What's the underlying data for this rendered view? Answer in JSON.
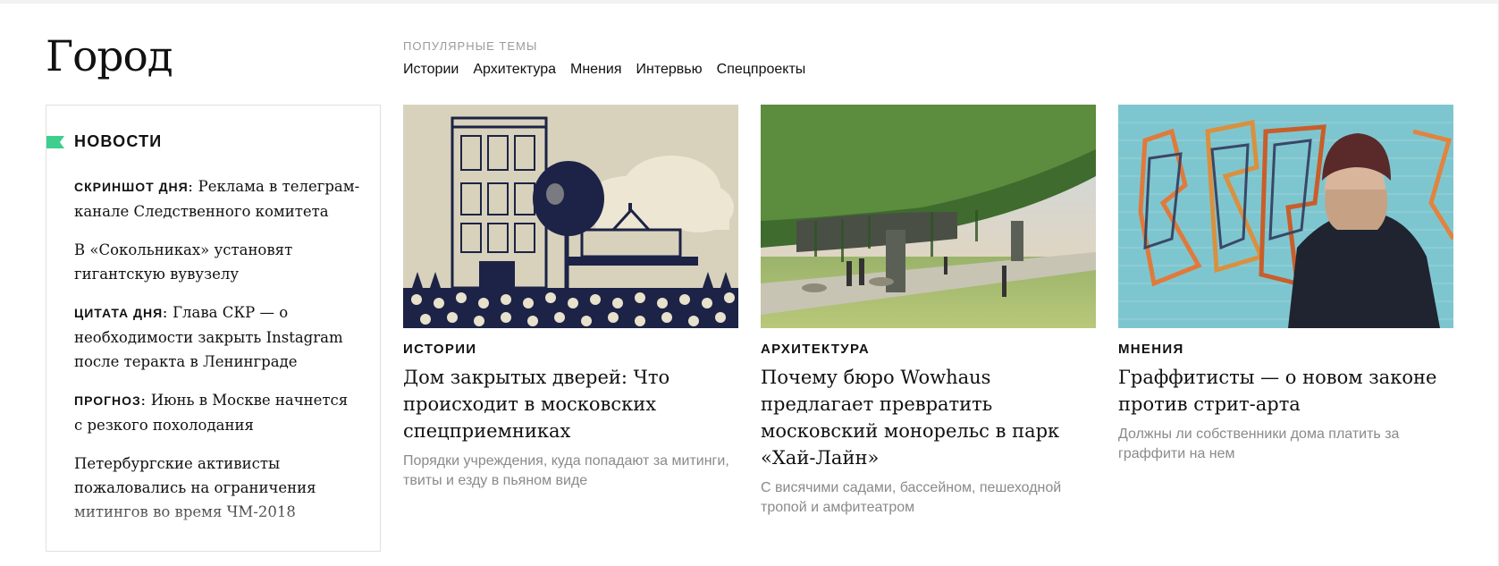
{
  "section": {
    "title": "Город"
  },
  "popular": {
    "label": "ПОПУЛЯРНЫЕ ТЕМЫ",
    "topics": [
      "Истории",
      "Архитектура",
      "Мнения",
      "Интервью",
      "Спецпроекты"
    ]
  },
  "news": {
    "heading": "НОВОСТИ",
    "flag_color": "#3ecf8e",
    "items": [
      {
        "tag": "СКРИНШОТ ДНЯ:",
        "text": "Реклама в телеграм-канале Следственного комитета"
      },
      {
        "tag": "",
        "text": "В «Сокольниках» установят гигантскую вувузелу"
      },
      {
        "tag": "ЦИТАТА ДНЯ:",
        "text": "Глава СКР — о необходимости закрыть Instagram после теракта в Ленинграде"
      },
      {
        "tag": "ПРОГНОЗ:",
        "text": "Июнь в Москве начнется с резкого похолодания"
      },
      {
        "tag": "",
        "text": "Петербургские активисты пожаловались на ограничения митингов во время ЧМ-2018"
      }
    ]
  },
  "cards": [
    {
      "rubric": "ИСТОРИИ",
      "title": "Дом закрытых дверей: Что происходит в московских спецприемниках",
      "lead": "Порядки учреждения, куда попадают за митинги, твиты и езду в пьяном виде",
      "image": "illustration-building"
    },
    {
      "rubric": "АРХИТЕКТУРА",
      "title": "Почему бюро Wowhaus предлагает превратить московский монорельс в парк «Хай-Лайн»",
      "lead": "С висячими садами, бассейном, пешеходной тропой и амфитеатром",
      "image": "photo-monorail-park"
    },
    {
      "rubric": "МНЕНИЯ",
      "title": "Граффитисты — о новом законе против стрит-арта",
      "lead": "Должны ли собственники дома платить за граффити на нем",
      "image": "photo-graffiti-wall"
    }
  ]
}
